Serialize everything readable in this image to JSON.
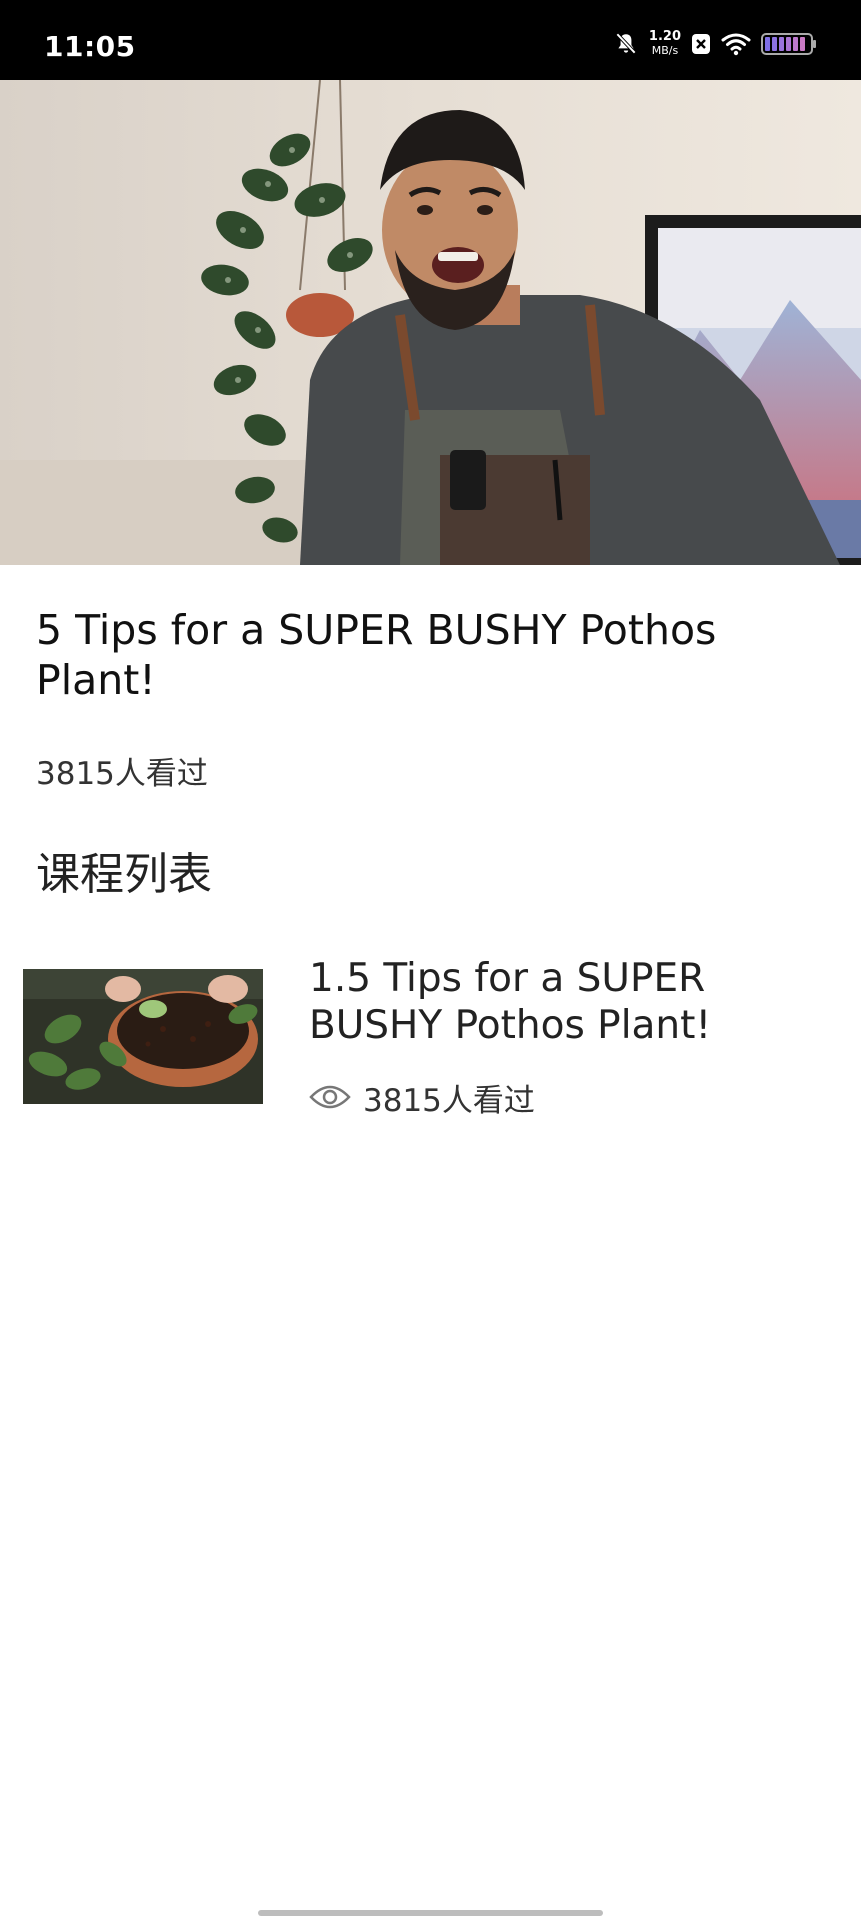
{
  "status_bar": {
    "time": "11:05",
    "net_speed_value": "1.20",
    "net_speed_unit": "MB/s",
    "icons": [
      "mute-icon",
      "notification-badge-icon",
      "wifi-icon",
      "battery-icon"
    ]
  },
  "video": {
    "title": "5 Tips for a SUPER BUSHY Pothos Plant!",
    "views": "3815人看过",
    "thumbnail": "presenter-with-pothos-plant"
  },
  "course_list": {
    "heading": "课程列表",
    "items": [
      {
        "title": "1.5 Tips for a SUPER BUSHY Pothos Plant!",
        "views": "3815人看过",
        "icon": "eye-icon",
        "thumbnail": "hands-potting-pothos"
      }
    ]
  },
  "colors": {
    "status_bar_bg": "#000000",
    "page_bg": "#ffffff",
    "text_primary": "#111111",
    "text_secondary": "#333333"
  }
}
